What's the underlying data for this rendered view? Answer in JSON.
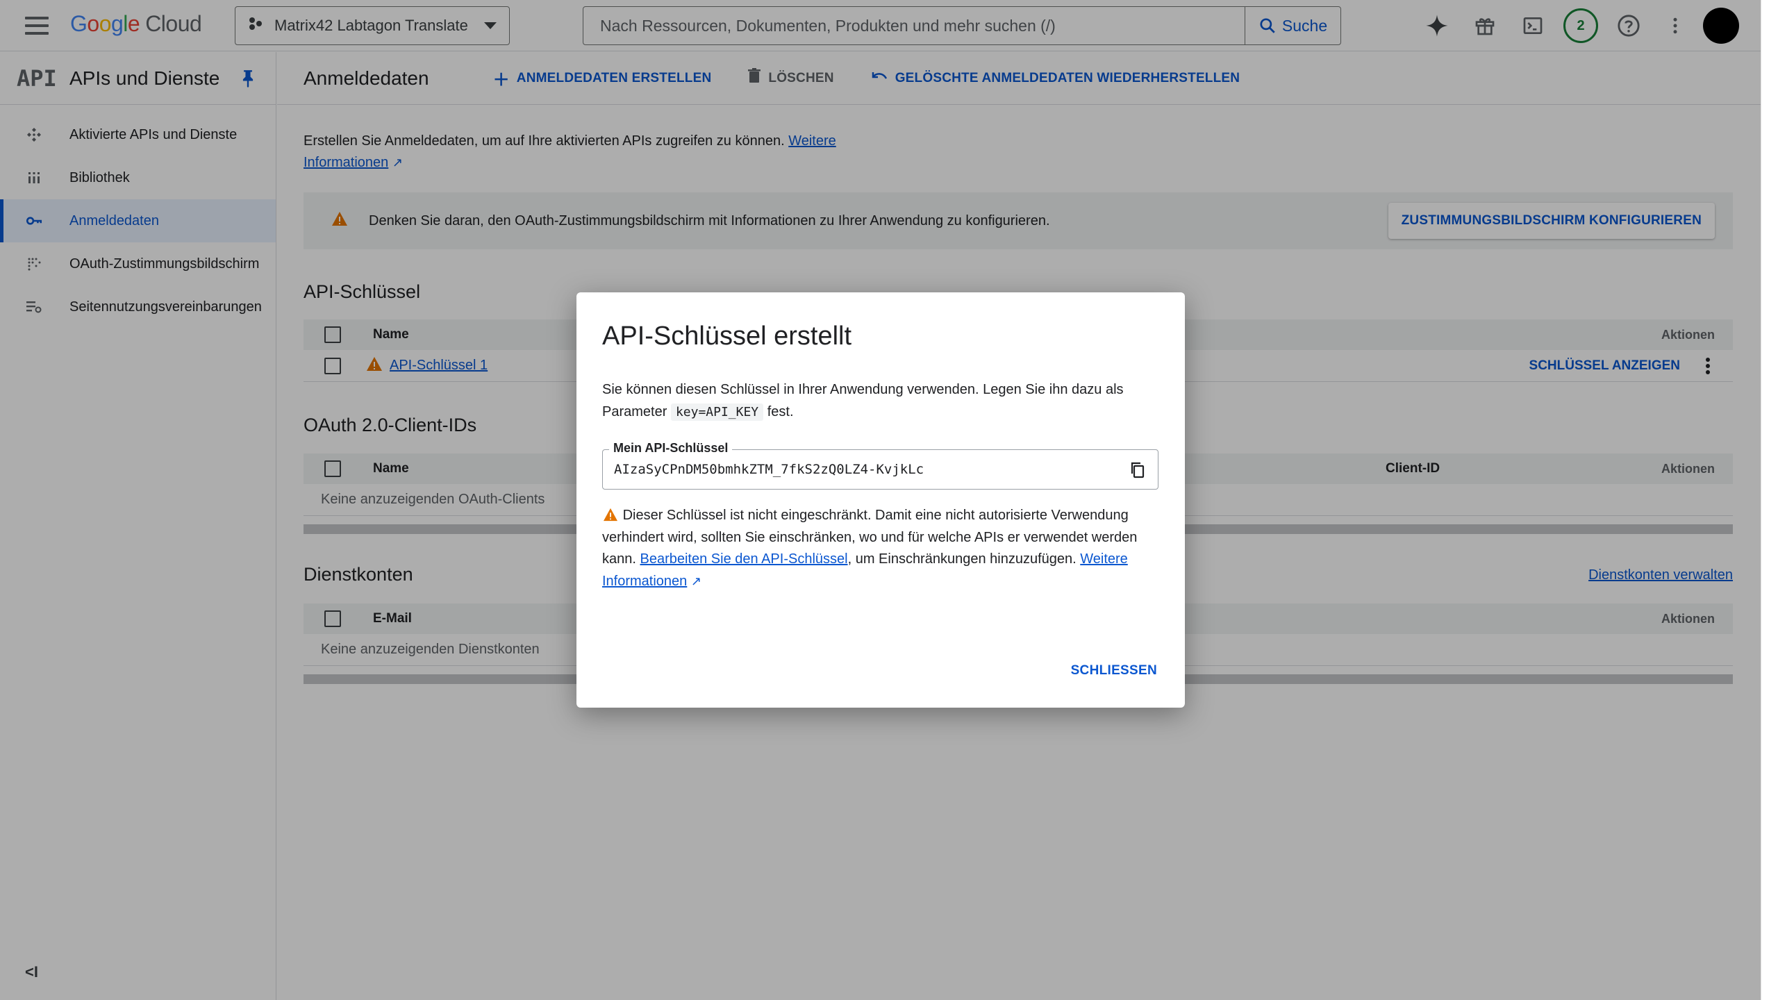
{
  "topbar": {
    "logo_parts": [
      "G",
      "o",
      "o",
      "g",
      "l",
      "e"
    ],
    "logo_cloud": "Cloud",
    "project_name": "Matrix42 Labtagon Translate",
    "search_placeholder": "Nach Ressourcen, Dokumenten, Produkten und mehr suchen (/)",
    "search_button": "Suche",
    "notification_count": "2",
    "icons": [
      "gemini-sparkle-icon",
      "gift-icon",
      "terminal-icon",
      "help-icon",
      "more-vert-icon"
    ]
  },
  "sidebar": {
    "logo_text": "API",
    "title": "APIs und Dienste",
    "items": [
      {
        "label": "Aktivierte APIs und Dienste",
        "icon": "apis-icon"
      },
      {
        "label": "Bibliothek",
        "icon": "library-icon"
      },
      {
        "label": "Anmeldedaten",
        "icon": "key-icon"
      },
      {
        "label": "OAuth-Zustimmungsbildschirm",
        "icon": "oauth-icon"
      },
      {
        "label": "Seitennutzungsvereinbarungen",
        "icon": "settings-list-icon"
      }
    ],
    "collapse_label": "<I"
  },
  "main": {
    "title": "Anmeldedaten",
    "actions": {
      "create": "ANMELDEDATEN ERSTELLEN",
      "delete": "LÖSCHEN",
      "restore": "GELÖSCHTE ANMELDEDATEN WIEDERHERSTELLEN"
    },
    "intro_text": "Erstellen Sie Anmeldedaten, um auf Ihre aktivierten APIs zugreifen zu können.",
    "intro_link": "Weitere Informationen",
    "banner_text": "Denken Sie daran, den OAuth-Zustimmungsbildschirm mit Informationen zu Ihrer Anwendung zu konfigurieren.",
    "banner_button": "ZUSTIMMUNGSBILDSCHIRM KONFIGURIEREN",
    "api_keys": {
      "title": "API-Schlüssel",
      "col_name": "Name",
      "col_actions": "Aktionen",
      "rows": [
        {
          "name": "API-Schlüssel 1",
          "action": "SCHLÜSSEL ANZEIGEN"
        }
      ]
    },
    "oauth": {
      "title": "OAuth 2.0-Client-IDs",
      "col_name": "Name",
      "col_client_id": "Client-ID",
      "col_actions": "Aktionen",
      "empty": "Keine anzuzeigenden OAuth-Clients"
    },
    "service_accounts": {
      "title": "Dienstkonten",
      "manage_link": "Dienstkonten verwalten",
      "col_email": "E-Mail",
      "col_actions": "Aktionen",
      "empty": "Keine anzuzeigenden Dienstkonten"
    }
  },
  "dialog": {
    "title": "API-Schlüssel erstellt",
    "text_before": "Sie können diesen Schlüssel in Ihrer Anwendung verwenden. Legen Sie ihn dazu als Parameter",
    "param_code": "key=API_KEY",
    "text_after": "fest.",
    "key_label": "Mein API-Schlüssel",
    "key_value": "AIzaSyCPnDM50bmhkZTM_7fkS2zQ0LZ4-KvjkLc",
    "warning_text_1": "Dieser Schlüssel ist nicht eingeschränkt. Damit eine nicht autorisierte Verwendung verhindert wird, sollten Sie einschränken, wo und für welche APIs er verwendet werden kann.",
    "warning_link_1": "Bearbeiten Sie den API-Schlüssel",
    "warning_text_2": ", um Einschränkungen hinzuzufügen.",
    "warning_link_2": "Weitere Informationen",
    "close_button": "SCHLIESSEN"
  },
  "colors": {
    "accent": "#0b57d0",
    "warning": "#e37400",
    "badge": "#188038"
  }
}
